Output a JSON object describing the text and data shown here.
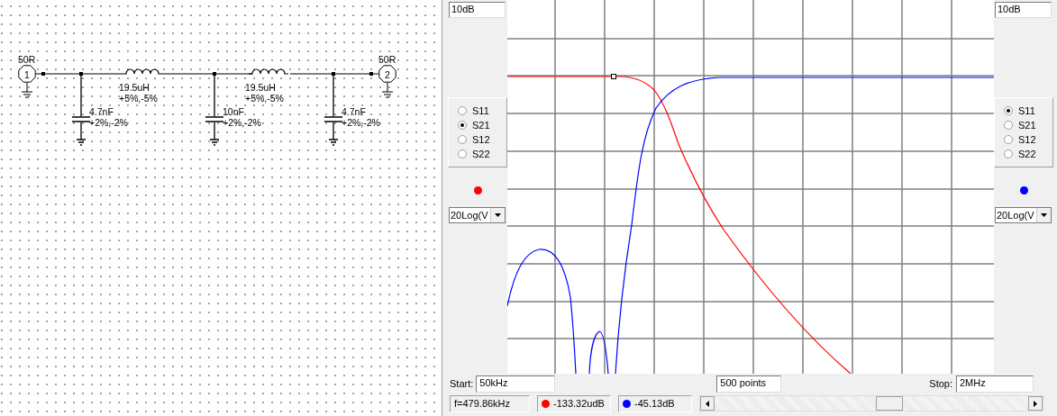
{
  "schematic": {
    "ports": [
      {
        "label": "50R",
        "number": "1"
      },
      {
        "label": "50R",
        "number": "2"
      }
    ],
    "inductors": [
      {
        "value": "19.5uH",
        "tolerance": "+5%,-5%"
      },
      {
        "value": "19.5uH",
        "tolerance": "+5%,-5%"
      }
    ],
    "capacitors": [
      {
        "value": "4.7nF",
        "tolerance": "+2%,-2%"
      },
      {
        "value": "10nF",
        "tolerance": "+2%,-2%"
      },
      {
        "value": "4.7nF",
        "tolerance": "+2%,-2%"
      }
    ]
  },
  "trace_panels": [
    {
      "scale": "10dB",
      "color": "#ff0000",
      "format": "20Log(V",
      "params": [
        {
          "label": "S11",
          "selected": false
        },
        {
          "label": "S21",
          "selected": true
        },
        {
          "label": "S12",
          "selected": false
        },
        {
          "label": "S22",
          "selected": false
        }
      ]
    },
    {
      "scale": "10dB",
      "color": "#0000ff",
      "format": "20Log(V",
      "params": [
        {
          "label": "S11",
          "selected": true
        },
        {
          "label": "S21",
          "selected": false
        },
        {
          "label": "S12",
          "selected": false
        },
        {
          "label": "S22",
          "selected": false
        }
      ]
    }
  ],
  "sweep": {
    "start_label": "Start:",
    "start": "50kHz",
    "points": "500 points",
    "stop_label": "Stop:",
    "stop": "2MHz"
  },
  "status_bar": {
    "frequency": "f=479.86kHz",
    "readouts": [
      {
        "color": "#ff0000",
        "value": "-133.32udB"
      },
      {
        "color": "#0000ff",
        "value": "-45.13dB"
      }
    ]
  }
}
